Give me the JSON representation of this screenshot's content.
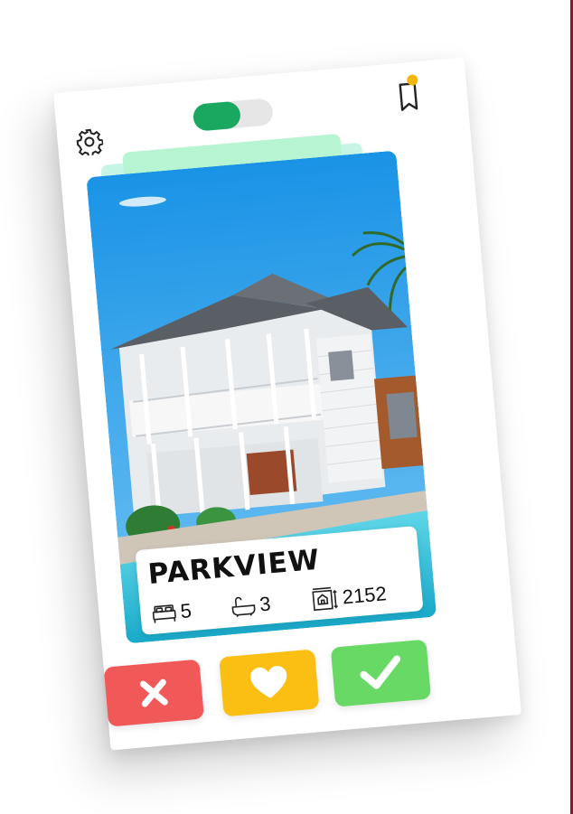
{
  "listing": {
    "name": "PARKVIEW",
    "bedrooms": "5",
    "bathrooms": "3",
    "area": "2152"
  },
  "toolbar": {
    "settings_icon": "gear-icon",
    "toggle_state": "on",
    "bookmark_icon": "bookmark-icon",
    "bookmark_badge": "notification-dot"
  },
  "actions": {
    "reject_icon": "close-icon",
    "like_icon": "heart-icon",
    "accept_icon": "check-icon"
  },
  "colors": {
    "toggle_on": "#1aa760",
    "reject": "#f15959",
    "like": "#fbbf13",
    "accept": "#68d964",
    "badge": "#f2b705"
  }
}
